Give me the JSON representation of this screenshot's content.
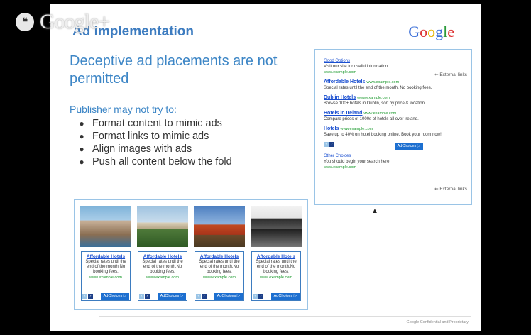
{
  "overlay": {
    "brand": "Google+",
    "hangout_icon": "hangout-quote-icon"
  },
  "slide": {
    "title": "Ad implementation",
    "logo": "Google",
    "headline": "Deceptive ad placements are not permitted",
    "publisher_title": "Publisher may not  try to:",
    "rules": [
      "Format content to mimic ads",
      "Format links to mimic ads",
      "Align images with ads",
      "Push all content below the fold"
    ],
    "footer": "Google Confidential and Proprietary"
  },
  "ad_box": {
    "good_options": "Good Options",
    "intro": "Visit our site for useful information",
    "intro_url": "www.example.com",
    "external_label": "External links",
    "ads": [
      {
        "title": "Affordable Hotels",
        "url": "www.example.com",
        "desc": "Special rates until the end of the month. No booking fees."
      },
      {
        "title": "Dublin Hotels",
        "url": "www.example.com",
        "desc": "Browse 100+ hotels in Dublin, sort by price & location."
      },
      {
        "title": "Hotels in Ireland",
        "url": "www.example.com",
        "desc": "Compare prices of 1000s of hotels all over ireland."
      },
      {
        "title": "Hotels",
        "url": "www.example.com",
        "desc": "Save up to 40% on hotel booking online. Book your room now!"
      }
    ],
    "adchoices": "AdChoices",
    "other_choices": "Other Choices",
    "other_text": "You should begin your search here.",
    "other_url": "www.example.com"
  },
  "tiles": [
    {
      "image": "coastal-cliffs",
      "title": "Affordable Hotels",
      "desc": "Special rates until the end of the month.No booking fees.",
      "url": "www.example.com",
      "adchoices": "AdChoices"
    },
    {
      "image": "greek-temple",
      "title": "Affordable Hotels",
      "desc": "Special rates until the end of the month.No booking fees.",
      "url": "www.example.com",
      "adchoices": "AdChoices"
    },
    {
      "image": "red-rock",
      "title": "Affordable Hotels",
      "desc": "Special rates until the end of the month.No booking fees.",
      "url": "www.example.com",
      "adchoices": "AdChoices"
    },
    {
      "image": "pagoda",
      "title": "Affordable Hotels",
      "desc": "Special rates until the end of the month.No booking fees.",
      "url": "www.example.com",
      "adchoices": "AdChoices"
    }
  ],
  "colors": {
    "accent": "#3d86c6",
    "link": "#1a4fd0",
    "url_green": "#1c9a2e",
    "adchoices_blue": "#1d6fd0"
  }
}
